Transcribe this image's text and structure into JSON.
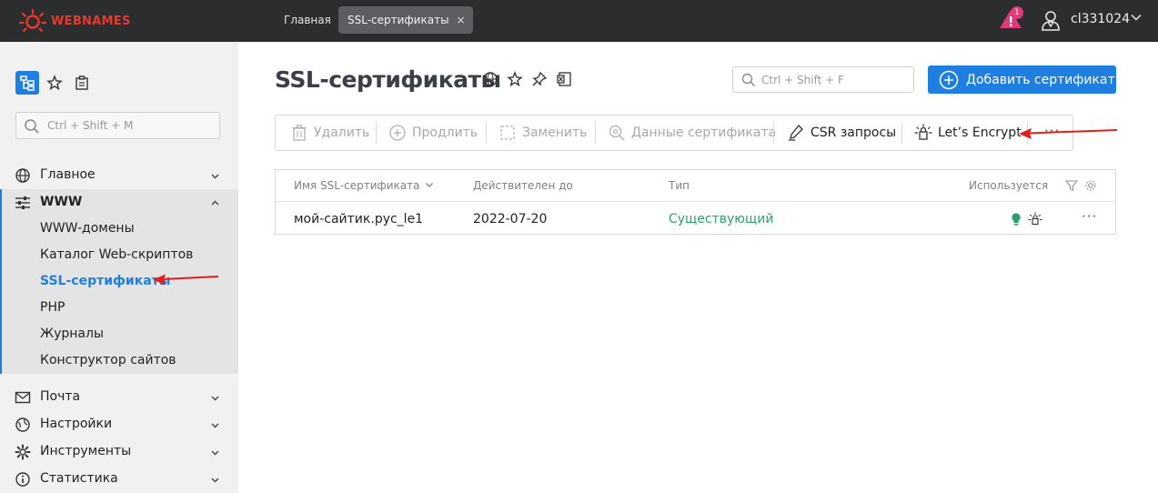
{
  "app": {
    "logo_text": "WEBNAMES"
  },
  "topbar": {
    "tabs": [
      {
        "label": "Главная"
      },
      {
        "label": "SSL-сертификаты",
        "close": "×"
      }
    ],
    "alert_count": "1",
    "user": "cl331024"
  },
  "sidebar": {
    "search_placeholder": "Ctrl + Shift + M",
    "groups": [
      {
        "label": "Главное",
        "icon": "globe-icon"
      },
      {
        "label": "WWW",
        "icon": "sliders-icon",
        "expanded": true
      },
      {
        "label": "Почта",
        "icon": "mail-icon"
      },
      {
        "label": "Настройки",
        "icon": "settings-globe-icon"
      },
      {
        "label": "Инструменты",
        "icon": "gear-icon"
      },
      {
        "label": "Статистика",
        "icon": "info-icon"
      }
    ],
    "www_items": [
      {
        "label": "WWW-домены"
      },
      {
        "label": "Каталог Web-скриптов"
      },
      {
        "label": "SSL-сертификаты",
        "active": true
      },
      {
        "label": "PHP"
      },
      {
        "label": "Журналы"
      },
      {
        "label": "Конструктор сайтов"
      }
    ]
  },
  "main": {
    "title": "SSL-сертификаты",
    "search_placeholder": "Ctrl + Shift + F",
    "add_button": "Добавить сертификат",
    "toolbar": {
      "delete": "Удалить",
      "renew": "Продлить",
      "replace": "Заменить",
      "cert_data": "Данные сертификата",
      "csr": "CSR запросы",
      "letsencrypt": "Let’s Encrypt",
      "more": "···"
    },
    "table": {
      "columns": {
        "name": "Имя SSL-сертификата",
        "valid_until": "Действителен до",
        "type": "Тип",
        "used": "Используется"
      },
      "rows": [
        {
          "name": "мой-сайтик.рус_le1",
          "valid_until": "2022-07-20",
          "type": "Существующий",
          "more": "···"
        }
      ]
    }
  },
  "colors": {
    "accent": "#1e7fe0",
    "brand": "#e8392b",
    "topbar": "#2c2d2f",
    "status_existing": "#2aa36b",
    "annotation_arrow": "#e0201c"
  }
}
